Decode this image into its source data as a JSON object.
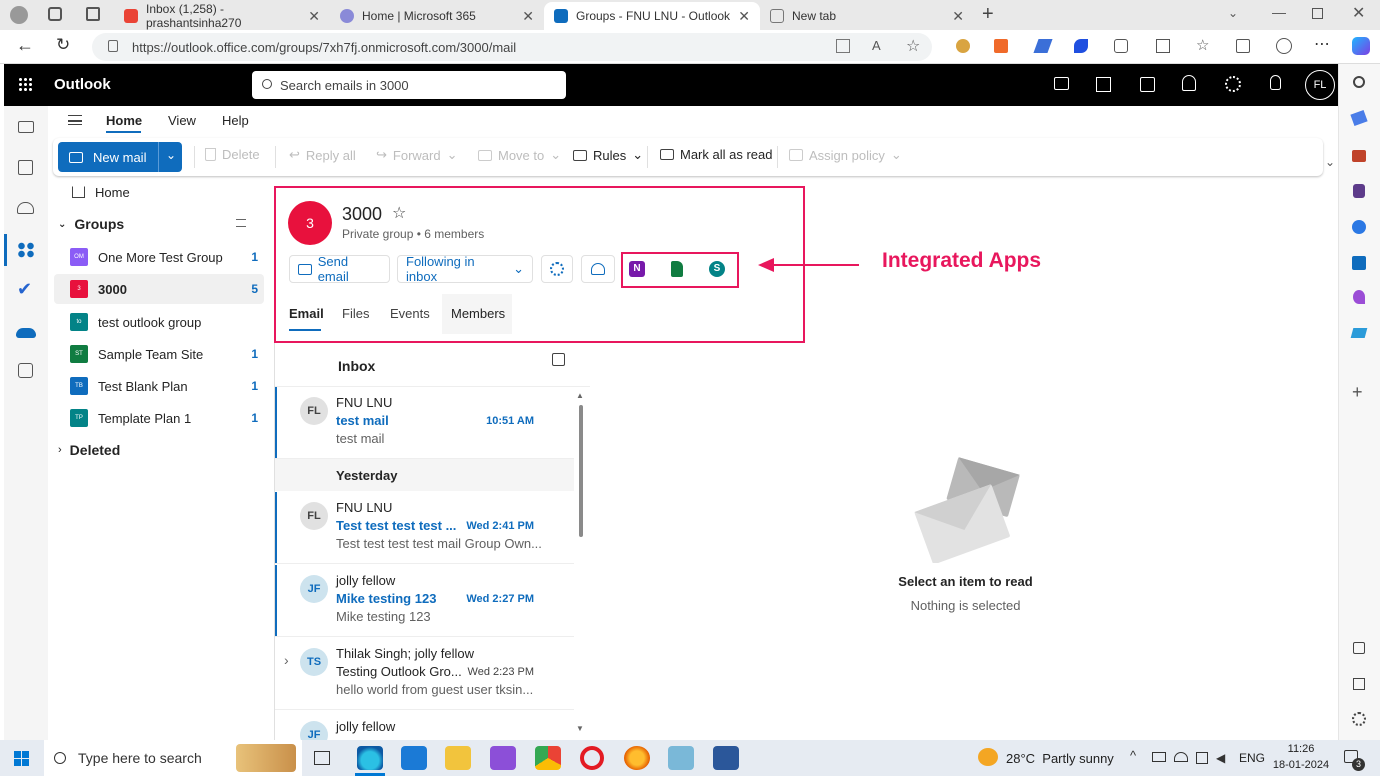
{
  "browser": {
    "tabs": [
      {
        "label": "Inbox (1,258) - prashantsinha270",
        "icon": "gmail-icon"
      },
      {
        "label": "Home | Microsoft 365",
        "icon": "m365-icon"
      },
      {
        "label": "Groups - FNU LNU - Outlook",
        "icon": "outlook-icon"
      },
      {
        "label": "New tab",
        "icon": "newtab-icon"
      }
    ],
    "url": "https://outlook.office.com/groups/7xh7fj.onmicrosoft.com/3000/mail"
  },
  "app": {
    "title": "Outlook",
    "search_placeholder": "Search emails in 3000",
    "user_initials": "FL"
  },
  "menu": {
    "home": "Home",
    "view": "View",
    "help": "Help"
  },
  "ribbon": {
    "new_mail": "New mail",
    "delete": "Delete",
    "reply_all": "Reply all",
    "forward": "Forward",
    "move_to": "Move to",
    "rules": "Rules",
    "mark_all_read": "Mark all as read",
    "assign_policy": "Assign policy"
  },
  "folders": {
    "home": "Home",
    "groups_label": "Groups",
    "deleted_label": "Deleted",
    "groups": [
      {
        "abbr": "OM",
        "name": "One More Test Group",
        "count": "1",
        "color": "#8b5cf6"
      },
      {
        "abbr": "3",
        "name": "3000",
        "count": "5",
        "color": "#e8113d"
      },
      {
        "abbr": "to",
        "name": "test outlook group",
        "count": "",
        "color": "#038387"
      },
      {
        "abbr": "ST",
        "name": "Sample Team Site",
        "count": "1",
        "color": "#107c41"
      },
      {
        "abbr": "TB",
        "name": "Test Blank Plan",
        "count": "1",
        "color": "#0f6cbd"
      },
      {
        "abbr": "TP",
        "name": "Template Plan 1",
        "count": "1",
        "color": "#038387"
      }
    ]
  },
  "group": {
    "avatar": "3",
    "name": "3000",
    "meta": "Private group • 6 members",
    "send_email": "Send email",
    "following": "Following in inbox",
    "tabs": [
      "Email",
      "Files",
      "Events",
      "Members"
    ],
    "annotation": "Integrated Apps",
    "apps": [
      "onenote-icon",
      "planner-icon",
      "sharepoint-icon"
    ]
  },
  "inbox": {
    "title": "Inbox",
    "yesterday": "Yesterday",
    "messages": [
      {
        "initials": "FL",
        "from": "FNU LNU",
        "subject": "test mail",
        "time": "10:51 AM",
        "preview": "test mail"
      },
      {
        "initials": "FL",
        "from": "FNU LNU",
        "subject": "Test test test test ...",
        "time": "Wed 2:41 PM",
        "preview": "Test test test test mail Group Own..."
      },
      {
        "initials": "JF",
        "from": "jolly fellow",
        "subject": "Mike testing 123",
        "time": "Wed 2:27 PM",
        "preview": "Mike testing 123"
      },
      {
        "initials": "TS",
        "from": "Thilak Singh; jolly fellow",
        "subject": "Testing Outlook Gro...",
        "time": "Wed 2:23 PM",
        "preview": "hello world from guest user tksin..."
      },
      {
        "initials": "JF",
        "from": "jolly fellow",
        "subject": "",
        "time": "",
        "preview": ""
      }
    ]
  },
  "reading": {
    "title": "Select an item to read",
    "subtitle": "Nothing is selected"
  },
  "taskbar": {
    "search_placeholder": "Type here to search",
    "weather": "28°C  Partly sunny",
    "lang": "ENG",
    "time": "11:26",
    "date": "18-01-2024",
    "notification_count": "3"
  },
  "colors": {
    "accent": "#0f6cbd",
    "annotation": "#e8175d"
  }
}
